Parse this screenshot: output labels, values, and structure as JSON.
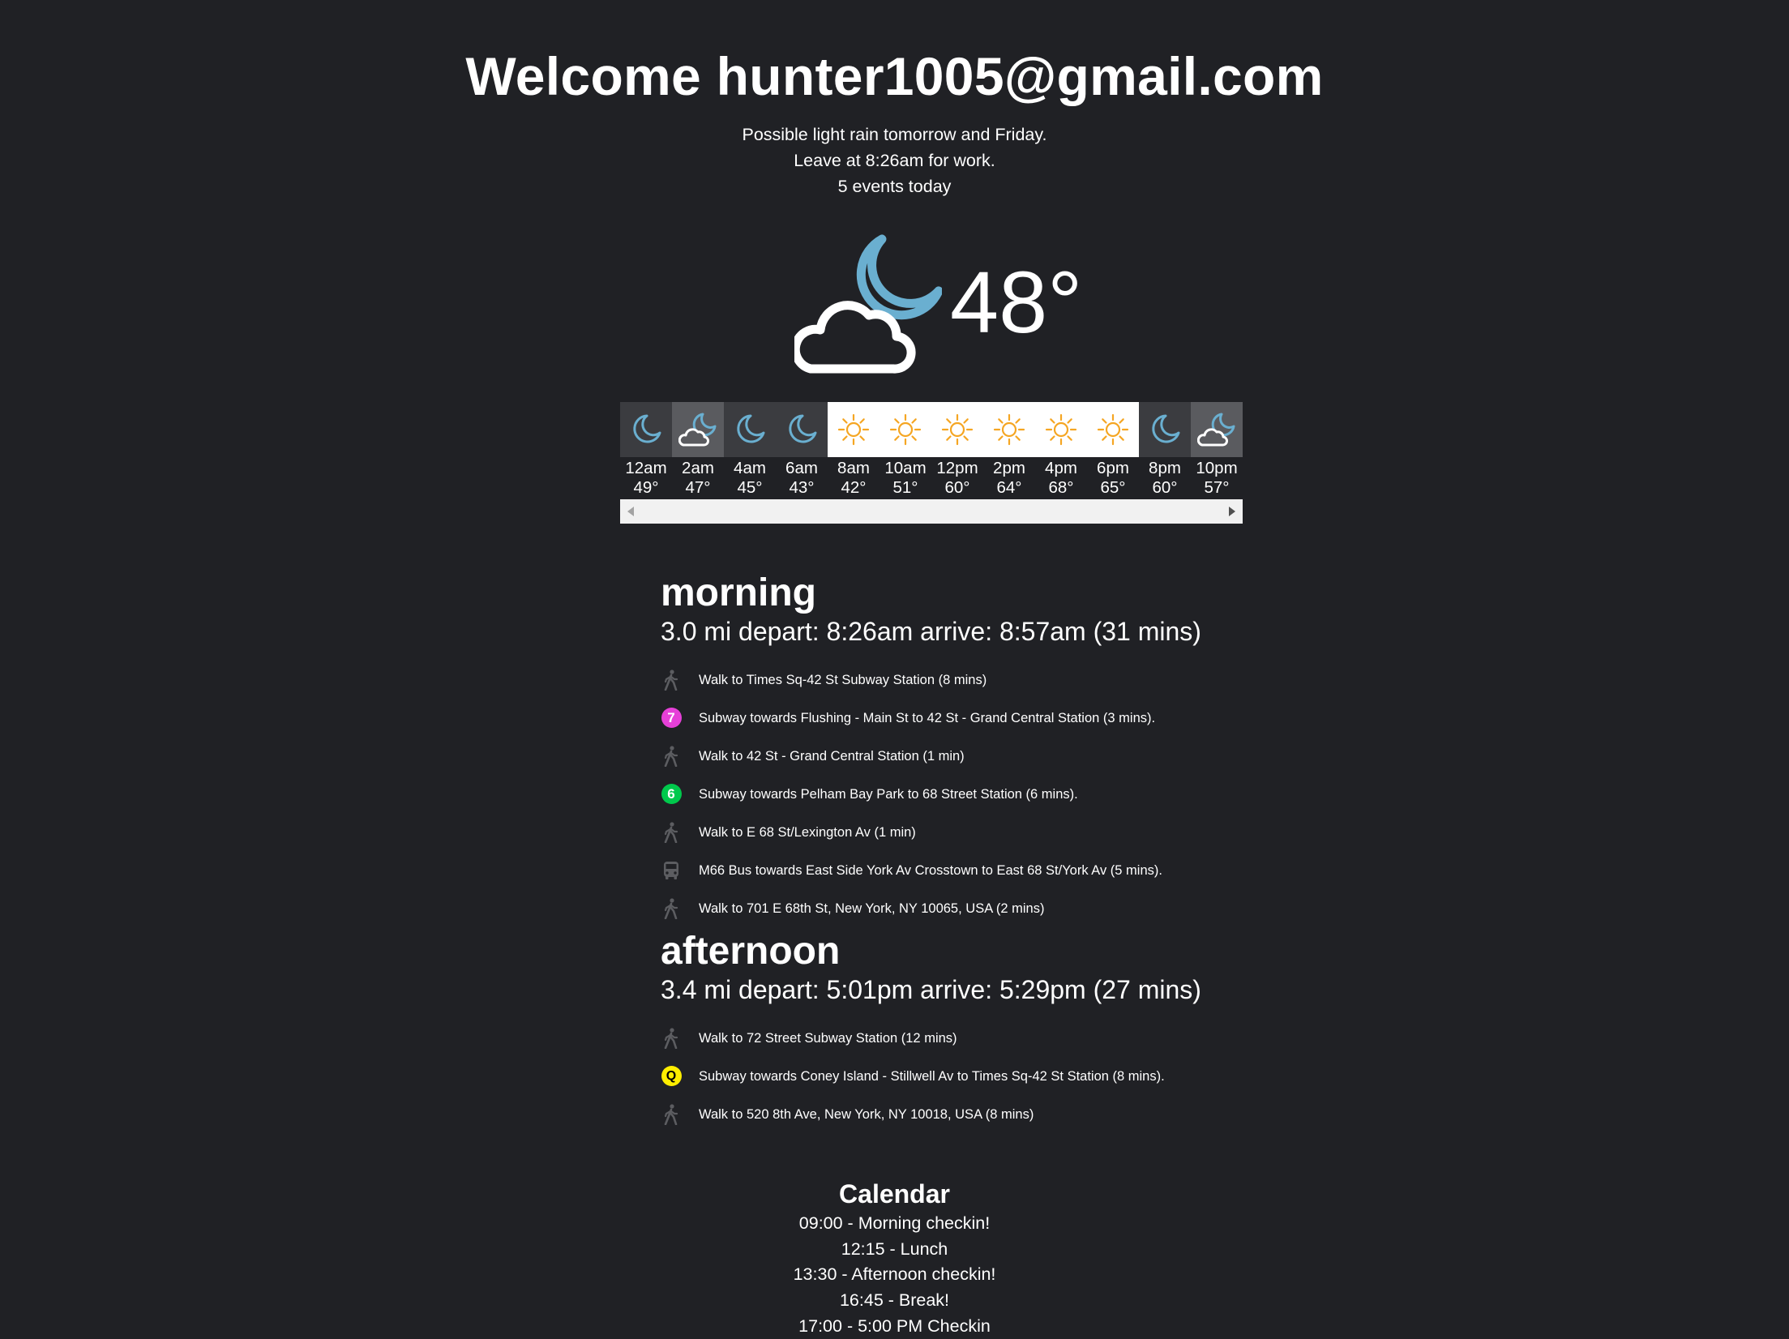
{
  "header": {
    "welcome": "Welcome hunter1005@gmail.com"
  },
  "summary": {
    "lines": [
      "Possible light rain tomorrow and Friday.",
      "Leave at 8:26am for work.",
      "5 events today"
    ]
  },
  "current_weather": {
    "icon": "partly-cloudy-night-icon",
    "temperature": "48°"
  },
  "hourly": [
    {
      "time": "12am",
      "temp": "49°",
      "icon": "moon-icon",
      "bg": "night"
    },
    {
      "time": "2am",
      "temp": "47°",
      "icon": "cloudy-night-icon",
      "bg": "night-cloud"
    },
    {
      "time": "4am",
      "temp": "45°",
      "icon": "moon-icon",
      "bg": "night"
    },
    {
      "time": "6am",
      "temp": "43°",
      "icon": "moon-icon",
      "bg": "night"
    },
    {
      "time": "8am",
      "temp": "42°",
      "icon": "sun-icon",
      "bg": "day"
    },
    {
      "time": "10am",
      "temp": "51°",
      "icon": "sun-icon",
      "bg": "day"
    },
    {
      "time": "12pm",
      "temp": "60°",
      "icon": "sun-icon",
      "bg": "day"
    },
    {
      "time": "2pm",
      "temp": "64°",
      "icon": "sun-icon",
      "bg": "day"
    },
    {
      "time": "4pm",
      "temp": "68°",
      "icon": "sun-icon",
      "bg": "day"
    },
    {
      "time": "6pm",
      "temp": "65°",
      "icon": "sun-icon",
      "bg": "day"
    },
    {
      "time": "8pm",
      "temp": "60°",
      "icon": "moon-icon",
      "bg": "night"
    },
    {
      "time": "10pm",
      "temp": "57°",
      "icon": "cloudy-night-icon",
      "bg": "night-cloud"
    }
  ],
  "colors": {
    "background": "#202125",
    "moon": "#6aafd0",
    "sun": "#f5a623",
    "line_7": "#e640d8",
    "line_6": "#00c94c",
    "line_q": "#ffee00",
    "icon_gray": "#5c5d61"
  },
  "commutes": [
    {
      "title": "morning",
      "summary": "3.0 mi depart: 8:26am arrive: 8:57am (31 mins)",
      "steps": [
        {
          "icon": "walk-icon",
          "text": "Walk to Times Sq-42 St Subway Station (8 mins)"
        },
        {
          "icon": "subway-7-icon",
          "badge": "7",
          "text": "Subway towards Flushing - Main St to 42 St - Grand Central Station (3 mins)."
        },
        {
          "icon": "walk-icon",
          "text": "Walk to 42 St - Grand Central Station (1 min)"
        },
        {
          "icon": "subway-6-icon",
          "badge": "6",
          "text": "Subway towards Pelham Bay Park to 68 Street Station (6 mins)."
        },
        {
          "icon": "walk-icon",
          "text": "Walk to E 68 St/Lexington Av (1 min)"
        },
        {
          "icon": "bus-icon",
          "text": "M66 Bus towards East Side York Av Crosstown to East 68 St/York Av (5 mins)."
        },
        {
          "icon": "walk-icon",
          "text": "Walk to 701 E 68th St, New York, NY 10065, USA (2 mins)"
        }
      ]
    },
    {
      "title": "afternoon",
      "summary": "3.4 mi depart: 5:01pm arrive: 5:29pm (27 mins)",
      "steps": [
        {
          "icon": "walk-icon",
          "text": "Walk to 72 Street Subway Station (12 mins)"
        },
        {
          "icon": "subway-q-icon",
          "badge": "Q",
          "text": "Subway towards Coney Island - Stillwell Av to Times Sq-42 St Station (8 mins)."
        },
        {
          "icon": "walk-icon",
          "text": "Walk to 520 8th Ave, New York, NY 10018, USA (8 mins)"
        }
      ]
    }
  ],
  "calendar": {
    "title": "Calendar",
    "events": [
      "09:00 - Morning checkin!",
      "12:15 - Lunch",
      "13:30 - Afternoon checkin!",
      "16:45 - Break!",
      "17:00 - 5:00 PM Checkin"
    ]
  }
}
